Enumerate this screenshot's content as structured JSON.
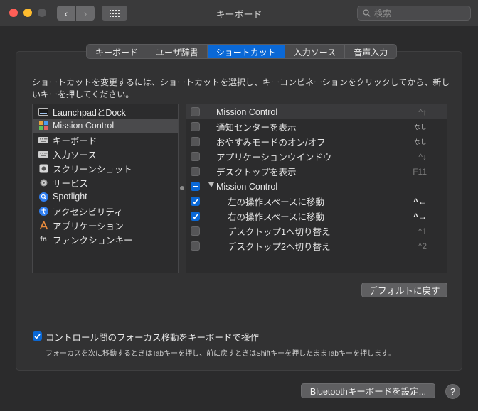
{
  "window": {
    "title": "キーボード"
  },
  "search": {
    "placeholder": "検索"
  },
  "tabs": [
    {
      "label": "キーボード",
      "active": false
    },
    {
      "label": "ユーザ辞書",
      "active": false
    },
    {
      "label": "ショートカット",
      "active": true
    },
    {
      "label": "入力ソース",
      "active": false
    },
    {
      "label": "音声入力",
      "active": false
    }
  ],
  "instruction": "ショートカットを変更するには、ショートカットを選択し、キーコンビネーションをクリックしてから、新しいキーを押してください。",
  "categories": [
    {
      "label": "LaunchpadとDock",
      "icon": "launchpad-dock-icon"
    },
    {
      "label": "Mission Control",
      "icon": "mission-control-icon",
      "selected": true
    },
    {
      "label": "キーボード",
      "icon": "keyboard-icon"
    },
    {
      "label": "入力ソース",
      "icon": "input-source-icon"
    },
    {
      "label": "スクリーンショット",
      "icon": "screenshot-icon"
    },
    {
      "label": "サービス",
      "icon": "gear-icon"
    },
    {
      "label": "Spotlight",
      "icon": "spotlight-icon"
    },
    {
      "label": "アクセシビリティ",
      "icon": "accessibility-icon"
    },
    {
      "label": "アプリケーション",
      "icon": "app-store-icon"
    },
    {
      "label": "ファンクションキー",
      "icon": "fn-icon"
    }
  ],
  "shortcuts": [
    {
      "label": "Mission Control",
      "key": "^↑",
      "checked": false,
      "header": true
    },
    {
      "label": "通知センターを表示",
      "key": "なし",
      "checked": false
    },
    {
      "label": "おやすみモードのオン/オフ",
      "key": "なし",
      "checked": false
    },
    {
      "label": "アプリケーションウインドウ",
      "key": "^↓",
      "checked": false
    },
    {
      "label": "デスクトップを表示",
      "key": "F11",
      "checked": false
    },
    {
      "label": "Mission Control",
      "key": "",
      "checked": "mixed",
      "group": true
    },
    {
      "label": "左の操作スペースに移動",
      "key": "^←",
      "checked": true,
      "sub": true
    },
    {
      "label": "右の操作スペースに移動",
      "key": "^→",
      "checked": true,
      "sub": true
    },
    {
      "label": "デスクトップ1へ切り替え",
      "key": "^1",
      "checked": false,
      "sub": true
    },
    {
      "label": "デスクトップ2へ切り替え",
      "key": "^2",
      "checked": false,
      "sub": true
    }
  ],
  "buttons": {
    "restore_defaults": "デフォルトに戻す",
    "bluetooth_setup": "Bluetoothキーボードを設定...",
    "help": "?"
  },
  "focus_control": {
    "checked": true,
    "label": "コントロール間のフォーカス移動をキーボードで操作",
    "description": "フォーカスを次に移動するときはTabキーを押し、前に戻すときはShiftキーを押したままTabキーを押します。"
  },
  "colors": {
    "accent": "#0a68d6",
    "close": "#ff5f57",
    "minimize": "#febc2e"
  }
}
